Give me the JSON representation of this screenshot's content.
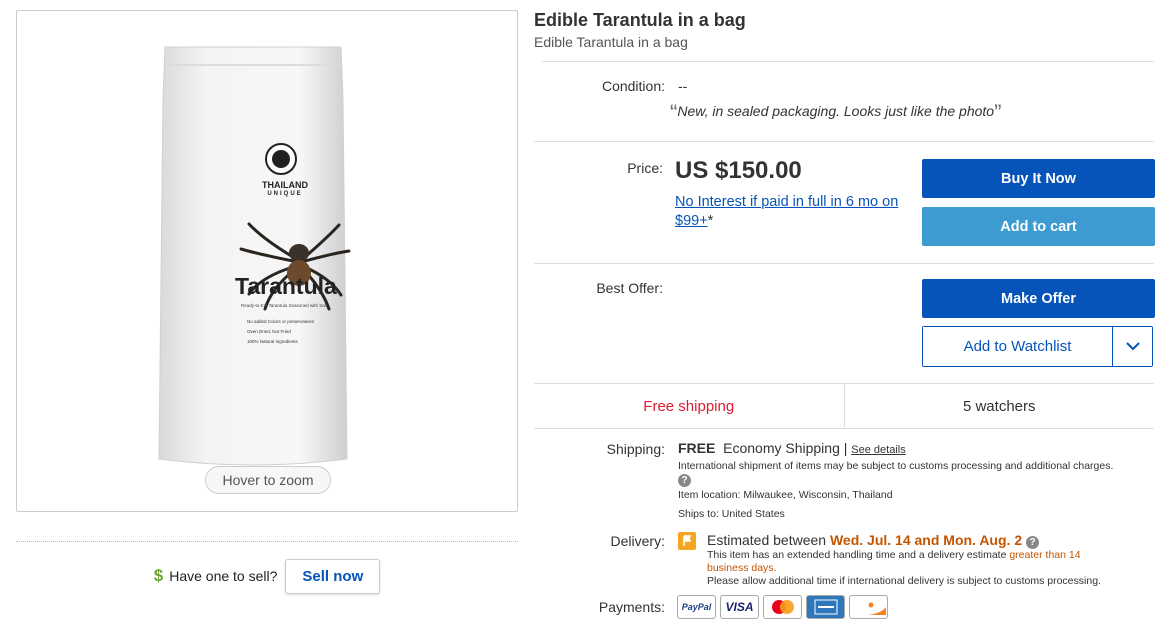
{
  "image_panel": {
    "bag_brand_line1": "THAILAND",
    "bag_brand_line2": "UNIQUE",
    "bag_product": "Tarantula",
    "bag_tagline": "Ready-to-Eat Tarantula Seasoned with Salt",
    "bag_checks": [
      "No added Colors or preservatives",
      "Oven Dried, Not Fried",
      "100% Natural Ingredients"
    ],
    "zoom_hint": "Hover to zoom"
  },
  "sell": {
    "prompt": "Have one to sell?",
    "button": "Sell now"
  },
  "item": {
    "title": "Edible Tarantula in a bag",
    "subtitle": "Edible Tarantula in a bag"
  },
  "condition": {
    "label": "Condition:",
    "value": "--",
    "seller_note": "New, in sealed packaging. Looks just like the photo"
  },
  "price": {
    "label": "Price:",
    "amount": "US $150.00",
    "financing_link": "No Interest if paid in full in 6 mo on $99+",
    "financing_suffix": "*"
  },
  "buttons": {
    "buy_now": "Buy It Now",
    "add_to_cart": "Add to cart",
    "make_offer": "Make Offer",
    "add_to_watchlist": "Add to Watchlist"
  },
  "best_offer": {
    "label": "Best Offer:"
  },
  "strip": {
    "free_shipping": "Free shipping",
    "watchers": "5 watchers"
  },
  "shipping": {
    "label": "Shipping:",
    "free": "FREE",
    "method": "Economy Shipping",
    "separator": "|",
    "see_details": "See details",
    "intl_note": "International shipment of items may be subject to customs processing and additional charges.",
    "location": "Item location:  Milwaukee, Wisconsin, Thailand",
    "ships_to": "Ships to:  United States"
  },
  "delivery": {
    "label": "Delivery:",
    "estimated_prefix": "Estimated between",
    "dates": "Wed. Jul. 14 and Mon. Aug. 2",
    "note_prefix": "This item has an extended handling time and a delivery estimate",
    "note_warn": "greater than 14 business days.",
    "note2": "Please allow additional time if international delivery is subject to customs processing."
  },
  "payments": {
    "label": "Payments:",
    "methods": [
      "PayPal",
      "VISA",
      "Mastercard",
      "American Express",
      "Discover"
    ]
  },
  "colors": {
    "primary_blue": "#0654ba",
    "secondary_blue": "#3e9bd2",
    "free_red": "#dd1e31",
    "delivery_orange": "#c45500"
  }
}
